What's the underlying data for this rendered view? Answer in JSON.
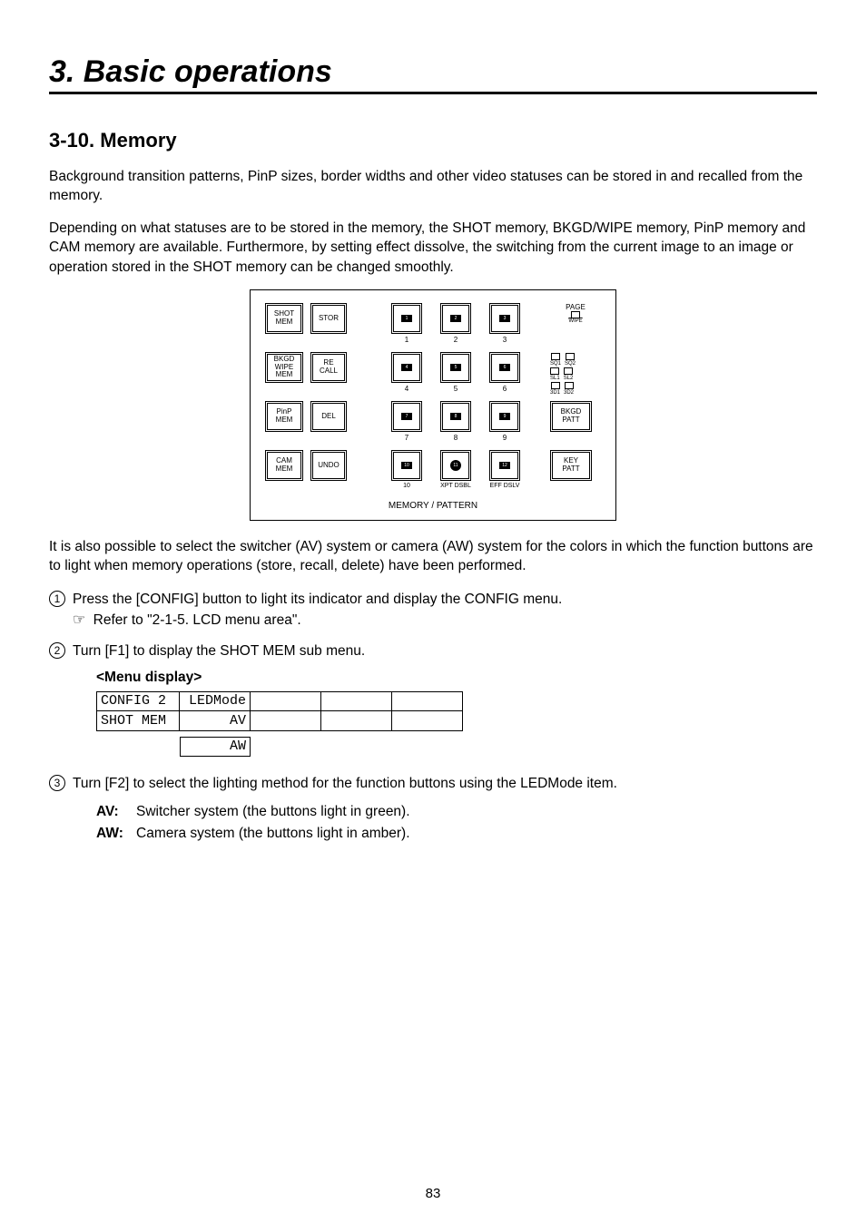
{
  "title": "3. Basic operations",
  "sect": "3-10. Memory",
  "p1": "Background transition patterns, PinP sizes, border widths and other video statuses can be stored in and recalled from the memory.",
  "p2": "Depending on what statuses are to be stored in the memory, the SHOT memory, BKGD/WIPE memory, PinP memory and CAM memory are available. Furthermore, by setting effect dissolve, the switching from the current image to an image or operation stored in the SHOT memory can be changed smoothly.",
  "panel": {
    "left": [
      [
        "SHOT\nMEM",
        "STOR"
      ],
      [
        "BKGD\nWIPE\nMEM",
        "RE\nCALL"
      ],
      [
        "PinP\nMEM",
        "DEL"
      ],
      [
        "CAM\nMEM",
        "UNDO"
      ]
    ],
    "nums": [
      [
        "1",
        "2",
        "3"
      ],
      [
        "4",
        "5",
        "6"
      ],
      [
        "7",
        "8",
        "9"
      ],
      [
        "10",
        "11",
        "12"
      ]
    ],
    "row4labels": [
      "10",
      "XPT DSBL",
      "EFF DSLV"
    ],
    "page": "PAGE",
    "wipe": "WIPE",
    "legend": [
      [
        "SQ1",
        "SQ2"
      ],
      [
        "SL1",
        "SL2"
      ],
      [
        "3D1",
        "3D2"
      ]
    ],
    "right": [
      "BKGD\nPATT",
      "KEY\nPATT"
    ],
    "caption": "MEMORY / PATTERN"
  },
  "p3": "It is also possible to select the switcher (AV) system or camera (AW) system for the colors in which the function buttons are to light when memory operations (store, recall, delete) have been performed.",
  "steps": {
    "s1": "Press the [CONFIG] button to light its indicator and display the CONFIG menu.",
    "s1ref": "Refer to \"2-1-5. LCD menu area\".",
    "s2": "Turn [F1] to display the SHOT MEM sub menu.",
    "s3": "Turn [F2] to select the lighting method for the function buttons using the LEDMode item."
  },
  "menu_heading": "<Menu display>",
  "menu": {
    "r1c1": "CONFIG 2",
    "r1c2": "LEDMode",
    "r2c1": "SHOT MEM",
    "r2c2": "     AV",
    "r3c2": "     AW"
  },
  "defs": {
    "av_k": "AV:",
    "av_v": "Switcher system (the buttons light in green).",
    "aw_k": "AW:",
    "aw_v": "Camera system (the buttons light in amber)."
  },
  "page_no": "83",
  "hand": "☞"
}
